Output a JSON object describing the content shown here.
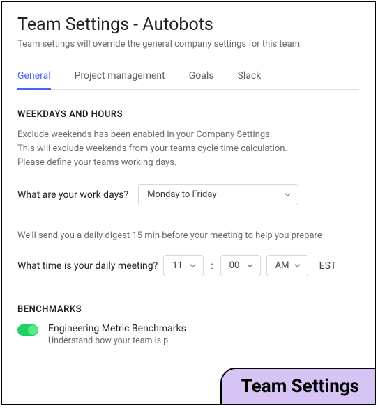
{
  "header": {
    "title": "Team Settings - Autobots",
    "subtitle": "Team settings will override the general company settings for this team"
  },
  "tabs": {
    "general": "General",
    "project": "Project management",
    "goals": "Goals",
    "slack": "Slack"
  },
  "weekdays": {
    "header": "WEEKDAYS AND HOURS",
    "info_line1": "Exclude weekends has been enabled in your Company Settings.",
    "info_line2": "This will exclude weekends from your teams cycle time calculation.",
    "info_line3": "Please define your teams working days.",
    "workdays_label": "What are your work days?",
    "workdays_value": "Monday to Friday"
  },
  "digest": {
    "info": "We'll send you a daily digest 15 min before your meeting to help you prepare",
    "label": "What time is your daily meeting?",
    "hour": "11",
    "minute": "00",
    "ampm": "AM",
    "tz": "EST",
    "colon": ":"
  },
  "benchmarks": {
    "header": "BENCHMARKS",
    "title": "Engineering Metric Benchmarks",
    "desc": "Understand how your team is p"
  },
  "badge": {
    "label": "Team Settings"
  }
}
